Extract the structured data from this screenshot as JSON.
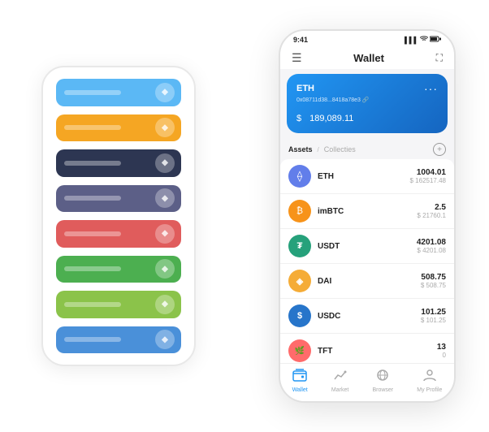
{
  "scene": {
    "bg_phone": {
      "cards": [
        {
          "color": "#5BB8F5",
          "icon": "◆"
        },
        {
          "color": "#F5A623",
          "icon": "◆"
        },
        {
          "color": "#2D3652",
          "icon": "◆"
        },
        {
          "color": "#5C5F87",
          "icon": "◆"
        },
        {
          "color": "#E05C5C",
          "icon": "◆"
        },
        {
          "color": "#4CAF50",
          "icon": "◆"
        },
        {
          "color": "#8BC34A",
          "icon": "◆"
        },
        {
          "color": "#4A90D9",
          "icon": "◆"
        }
      ]
    },
    "phone": {
      "status_bar": {
        "time": "9:41",
        "signal": "▌▌▌",
        "wifi": "wifi",
        "battery": "battery"
      },
      "header": {
        "menu_icon": "☰",
        "title": "Wallet",
        "expand_icon": "⛶"
      },
      "eth_card": {
        "label": "ETH",
        "address": "0x08711d38...8418a78e3 🔗",
        "dots": "···",
        "balance_symbol": "$",
        "balance": "189,089.11"
      },
      "assets_section": {
        "tab_active": "Assets",
        "separator": "/",
        "tab_inactive": "Collecties",
        "add_icon": "+"
      },
      "assets": [
        {
          "symbol": "ETH",
          "icon_bg": "#627EEA",
          "icon_char": "⟠",
          "amount": "1004.01",
          "usd": "$ 162517.48"
        },
        {
          "symbol": "imBTC",
          "icon_bg": "#F7931A",
          "icon_char": "₿",
          "amount": "2.5",
          "usd": "$ 21760.1"
        },
        {
          "symbol": "USDT",
          "icon_bg": "#26A17B",
          "icon_char": "₮",
          "amount": "4201.08",
          "usd": "$ 4201.08"
        },
        {
          "symbol": "DAI",
          "icon_bg": "#F5AC37",
          "icon_char": "◈",
          "amount": "508.75",
          "usd": "$ 508.75"
        },
        {
          "symbol": "USDC",
          "icon_bg": "#2775CA",
          "icon_char": "$",
          "amount": "101.25",
          "usd": "$ 101.25"
        },
        {
          "symbol": "TFT",
          "icon_bg": "#FF6B6B",
          "icon_char": "🌿",
          "amount": "13",
          "usd": "0"
        }
      ],
      "bottom_nav": [
        {
          "label": "Wallet",
          "active": true,
          "icon": "wallet"
        },
        {
          "label": "Market",
          "active": false,
          "icon": "chart"
        },
        {
          "label": "Browser",
          "active": false,
          "icon": "browser"
        },
        {
          "label": "My Profile",
          "active": false,
          "icon": "profile"
        }
      ]
    }
  }
}
